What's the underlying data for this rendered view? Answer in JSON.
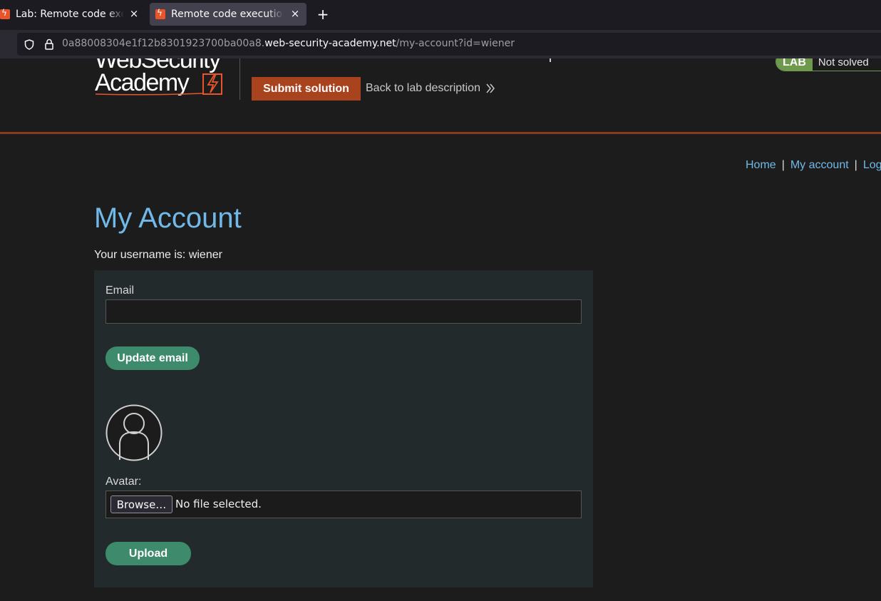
{
  "browser": {
    "tabs": [
      {
        "title": "Lab: Remote code execution via web shell upload",
        "close": "×",
        "active": false
      },
      {
        "title": "Remote code execution via web shell upload",
        "close": "×",
        "active": true
      }
    ],
    "new_tab": "+",
    "url": {
      "prefix": "0a88008304e1f12b8301923700ba00a8.",
      "domain": "web-security-academy.net",
      "path": "/my-account?id=wiener"
    }
  },
  "header": {
    "logo_line1": "WebSecurity",
    "logo_line2": "Academy",
    "submit_label": "Submit solution",
    "back_label": "Back to lab description",
    "lab_badge": "LAB",
    "lab_status": "Not solved"
  },
  "nav": {
    "items": [
      {
        "label": "Home"
      },
      {
        "label": "My account"
      },
      {
        "label": "Log out"
      }
    ],
    "separator": "|"
  },
  "main": {
    "title": "My Account",
    "username_text": "Your username is: wiener",
    "email_label": "Email",
    "email_value": "",
    "update_email_label": "Update email",
    "avatar_label": "Avatar:",
    "browse_label": "Browse…",
    "file_status": "No file selected.",
    "upload_label": "Upload"
  },
  "colors": {
    "accent_blue": "#70b9e8",
    "submit_orange": "#a9431e",
    "button_green": "#3e8a6d",
    "lab_green": "#6f9a4d"
  }
}
